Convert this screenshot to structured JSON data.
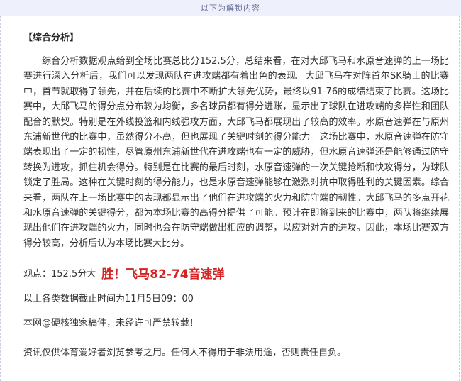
{
  "banner": {
    "text": "以下为解锁内容"
  },
  "article": {
    "heading": "【综合分析】",
    "paragraph": "综合分析数据观点给到全场比赛总比分152.5分，总结来看，在对大邱飞马和水原音速弹的上一场比赛进行深入分析后，我们可以发现两队在进攻端都有着出色的表现。大邱飞马在对阵首尔SK骑士的比赛中，首节就取得了领先，并在后续的比赛中不断扩大领先优势，最终以91-76的成绩结束了比赛。这场比赛中，大邱飞马的得分点分布较为均衡，多名球员都有得分进账，显示出了球队在进攻端的多样性和团队配合的默契。特别是在外线投篮和内线强攻方面，大邱飞马都展现出了较高的效率。水原音速弹在与原州东浦新世代的比赛中，虽然得分不高，但也展现了关键时刻的得分能力。这场比赛中，水原音速弹在防守端表现出了一定的韧性，尽管原州东浦新世代在进攻端也有一定的威胁，但水原音速弹还是能够通过防守转换为进攻，抓住机会得分。特别是在比赛的最后时刻，水原音速弹的一次关键抢断和快攻得分，为球队锁定了胜局。这种在关键时刻的得分能力，也是水原音速弹能够在激烈对抗中取得胜利的关键因素。综合来看，两队在上一场比赛中的表现都显示出了他们在进攻端的火力和防守端的韧性。大邱飞马的多点开花和水原音速弹的关键得分，都为本场比赛的高得分提供了可能。预计在即将到来的比赛中，两队将继续展现出他们在进攻端的火力，同时也会在防守端做出相应的调整，以应对对方的进攻。因此，本场比赛双方得分较高，分析后认为本场比赛大比分。",
    "verdict": {
      "label": "观点：",
      "value": "152.5分大",
      "result": "胜！飞马82-74音速弹",
      "result_color": "#d42323"
    },
    "deadline": "以上各类数据截止时间为11月5日09：00",
    "copyright": "本网@硬核独家稿件，未经许可严禁转载！",
    "disclaimer": "资讯仅供体育爱好者浏览参考之用。任何人不得用于非法用途，否则责任自负。"
  }
}
